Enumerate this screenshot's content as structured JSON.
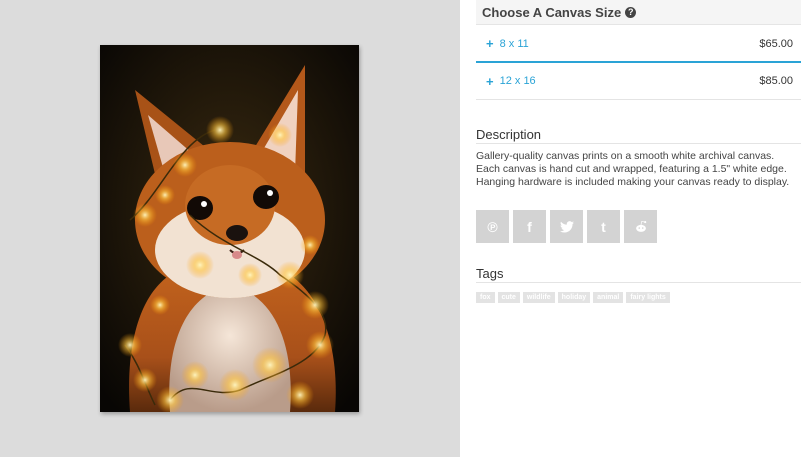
{
  "sizes": {
    "header": "Choose A Canvas Size",
    "help_icon": "question-circle-icon",
    "options": [
      {
        "label": "8 x 11",
        "price": "$65.00"
      },
      {
        "label": "12 x 16",
        "price": "$85.00"
      }
    ]
  },
  "description": {
    "title": "Description",
    "text": "Gallery-quality canvas prints on a smooth white archival canvas. Each canvas is hand cut and wrapped, featuring a 1.5\" white edge. Hanging hardware is included making your canvas ready to display."
  },
  "share": {
    "buttons": [
      {
        "icon": "pinterest-icon",
        "glyph": "℗"
      },
      {
        "icon": "facebook-icon",
        "glyph": "f"
      },
      {
        "icon": "twitter-icon",
        "glyph": "🐦"
      },
      {
        "icon": "tumblr-icon",
        "glyph": "t"
      },
      {
        "icon": "reddit-icon",
        "glyph": "◉"
      }
    ]
  },
  "tags": {
    "title": "Tags",
    "items": [
      "fox",
      "cute",
      "wildlife",
      "holiday",
      "animal",
      "fairy lights"
    ]
  },
  "colors": {
    "accent": "#2aa3d6",
    "preview_bg": "#dcdcdc",
    "share_btn": "#d3d3d3",
    "tag_bg": "#e3e3e3"
  }
}
